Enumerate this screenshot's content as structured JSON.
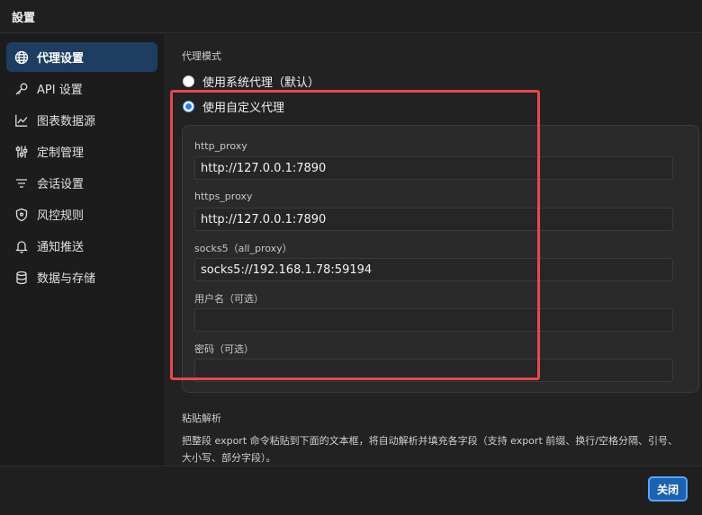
{
  "window": {
    "title": "設置"
  },
  "sidebar": {
    "items": [
      {
        "label": "代理设置",
        "icon": "globe-icon",
        "active": true
      },
      {
        "label": "API 设置",
        "icon": "key-icon",
        "active": false
      },
      {
        "label": "图表数据源",
        "icon": "line-chart-icon",
        "active": false
      },
      {
        "label": "定制管理",
        "icon": "sliders-icon",
        "active": false
      },
      {
        "label": "会话设置",
        "icon": "filter-lines-icon",
        "active": false
      },
      {
        "label": "风控规则",
        "icon": "shield-icon",
        "active": false
      },
      {
        "label": "通知推送",
        "icon": "bell-icon",
        "active": false
      },
      {
        "label": "数据与存储",
        "icon": "database-icon",
        "active": false
      }
    ]
  },
  "proxy": {
    "section_title": "代理模式",
    "mode_system": "使用系统代理（默认）",
    "mode_custom": "使用自定义代理",
    "selected_mode": "custom",
    "fields": {
      "http_label": "http_proxy",
      "http_value": "http://127.0.0.1:7890",
      "https_label": "https_proxy",
      "https_value": "http://127.0.0.1:7890",
      "socks_label": "socks5（all_proxy）",
      "socks_value": "socks5://192.168.1.78:59194",
      "username_label": "用户名（可选）",
      "username_value": "",
      "password_label": "密码（可选）",
      "password_value": ""
    }
  },
  "paste": {
    "title": "粘贴解析",
    "description": "把整段 export 命令粘贴到下面的文本框，将自动解析并填充各字段（支持 export 前缀、换行/空格分隔、引号、大小写、部分字段）。"
  },
  "footer": {
    "close_label": "关闭"
  },
  "colors": {
    "accent": "#1d62b0",
    "active_nav": "#1d3e61",
    "highlight": "#e5484d"
  }
}
